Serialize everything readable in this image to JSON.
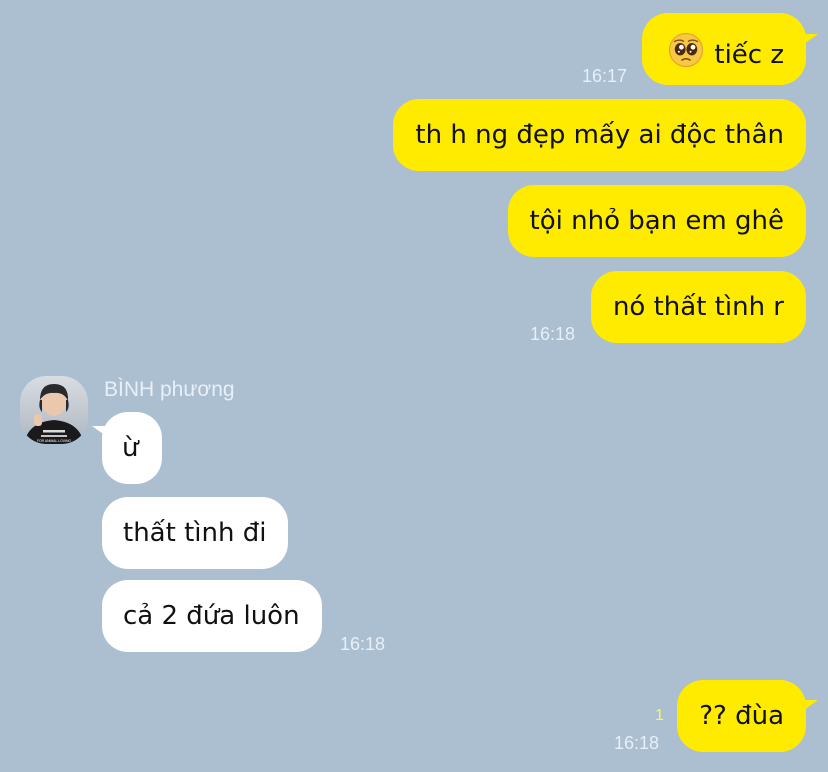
{
  "messages": {
    "m1": {
      "emoji": "pleading-face",
      "text": "tiếc z",
      "time": "16:17"
    },
    "m2": {
      "text": "th h ng đẹp mấy ai độc thân"
    },
    "m3": {
      "text": "tội nhỏ bạn em ghê"
    },
    "m4": {
      "text": "nó thất tình r",
      "time": "16:18"
    },
    "incoming": {
      "sender": "BÌNH phương",
      "avatar_text": "FOR ANIMAL LOVING",
      "b1": "ừ",
      "b2": "thất tình đi",
      "b3": "cả 2 đứa luôn",
      "time": "16:18"
    },
    "m5": {
      "text": "?? đùa",
      "unread": "1",
      "time": "16:18"
    }
  },
  "colors": {
    "background": "#abbfd1",
    "my_bubble": "#ffeb00",
    "other_bubble": "#ffffff",
    "timestamp": "#e9eff6",
    "unread_count": "#fffb3c"
  }
}
